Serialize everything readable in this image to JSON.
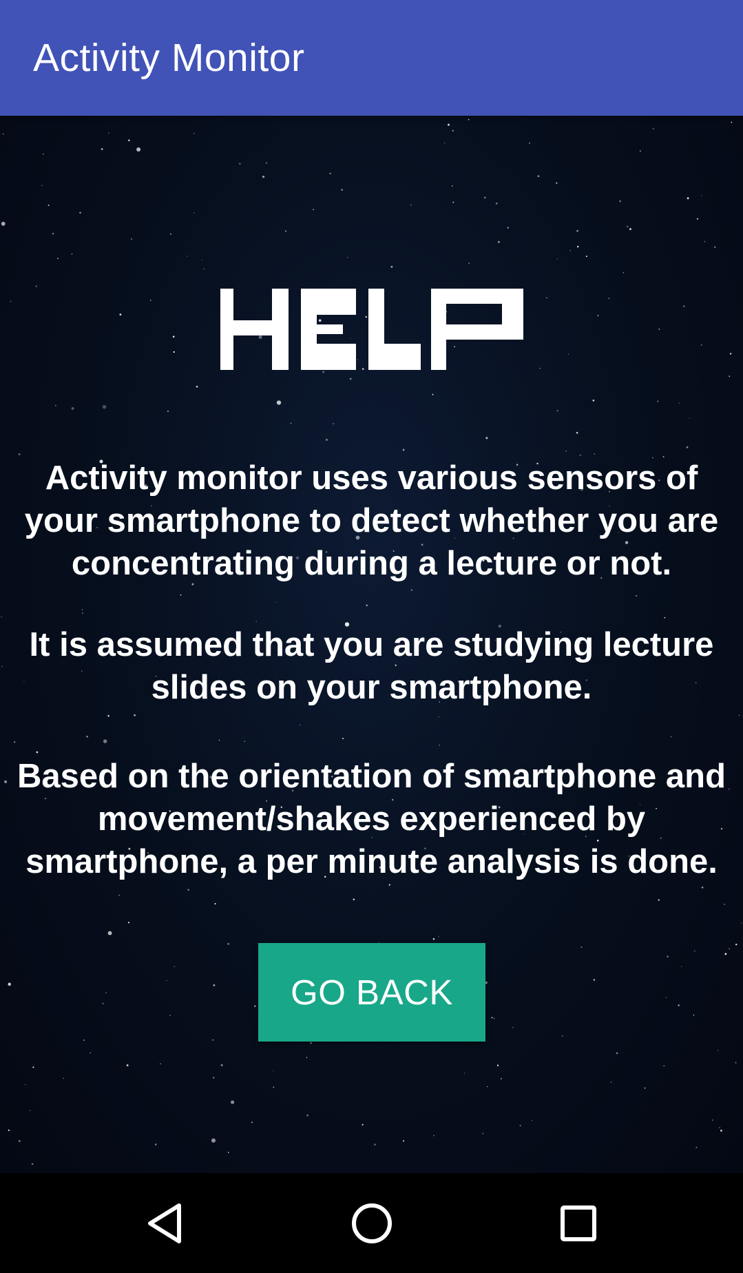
{
  "app_bar": {
    "title": "Activity Monitor",
    "background_color": "#4153b6"
  },
  "main": {
    "heading": "HELP",
    "paragraphs": [
      "Activity monitor uses various sensors of your smartphone to detect whether you are concentrating during a lecture or not.",
      "It is assumed that you are studying lecture slides on your smartphone.",
      "Based on the orientation of smartphone and movement/shakes experienced by smartphone, a per minute analysis is done."
    ],
    "go_back_label": "GO BACK",
    "button_color": "#18a889"
  },
  "nav_bar": {
    "items": [
      {
        "icon": "back-triangle-icon"
      },
      {
        "icon": "home-circle-icon"
      },
      {
        "icon": "recent-apps-square-icon"
      }
    ]
  }
}
